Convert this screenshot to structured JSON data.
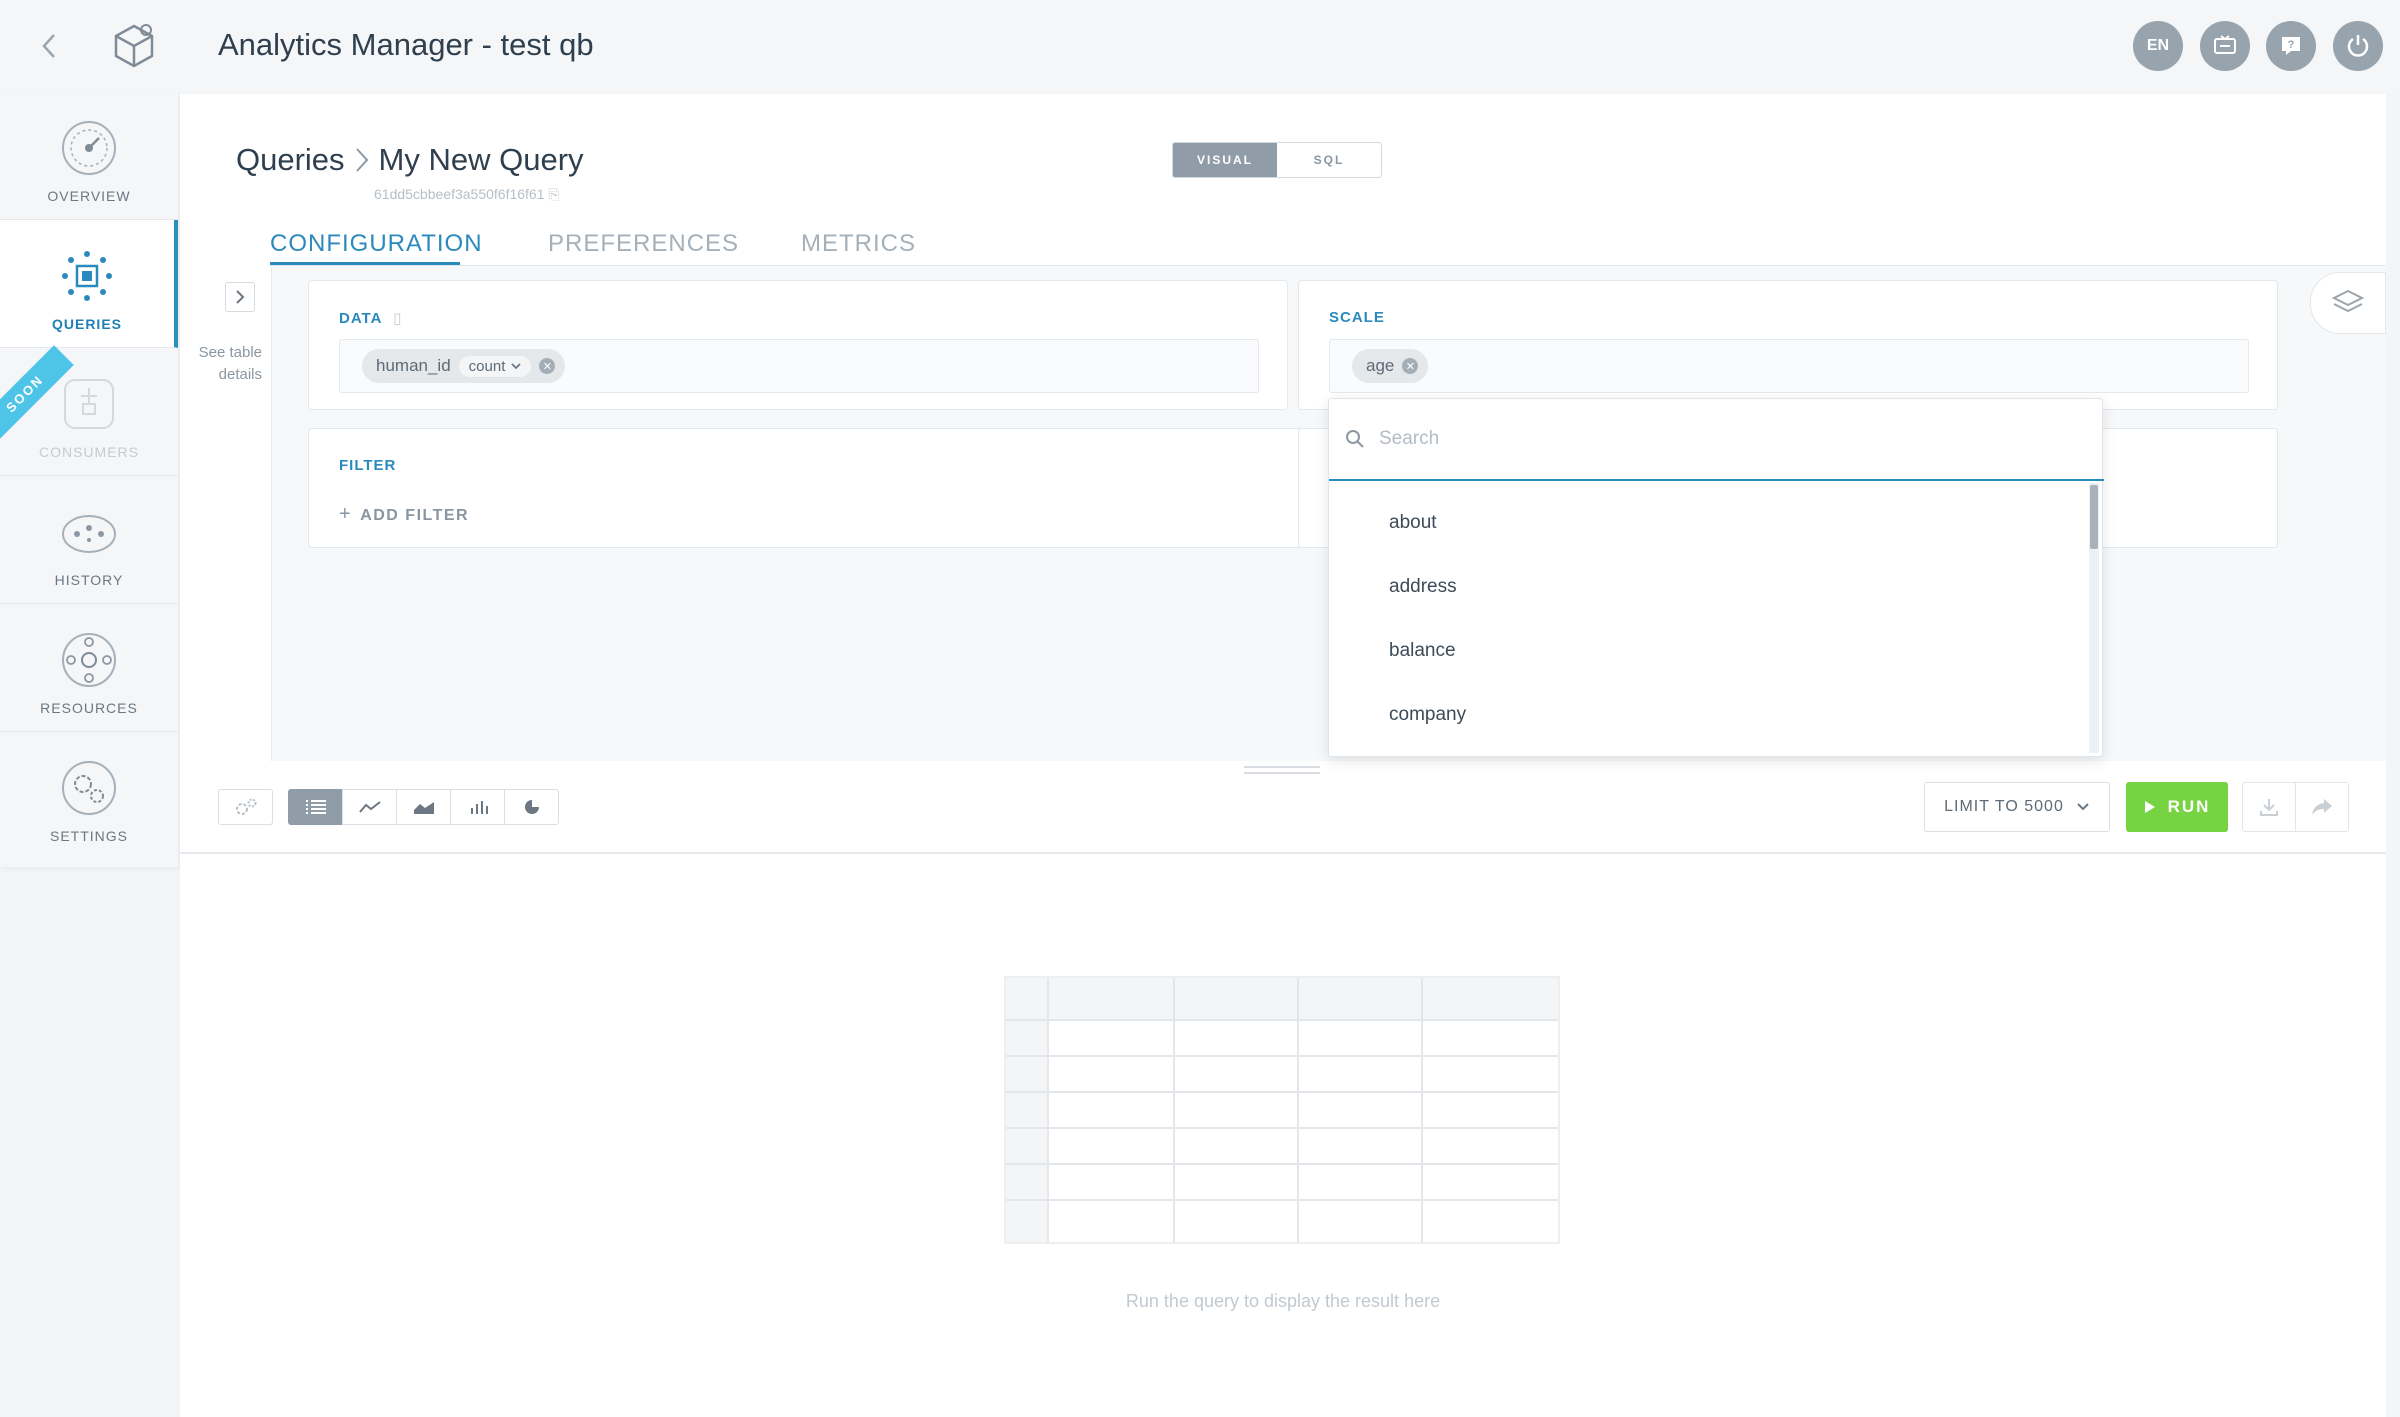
{
  "header": {
    "title": "Analytics Manager - test qb",
    "language": "EN",
    "icons": [
      "chevron-left-icon",
      "cube-logo-icon",
      "screen-icon",
      "help-icon",
      "power-icon"
    ]
  },
  "sidebar": {
    "items": [
      {
        "label": "OVERVIEW",
        "icon": "overview-icon",
        "active": false
      },
      {
        "label": "QUERIES",
        "icon": "queries-icon",
        "active": true
      },
      {
        "label": "CONSUMERS",
        "icon": "consumers-icon",
        "active": false,
        "disabled": true,
        "badge": "SOON"
      },
      {
        "label": "HISTORY",
        "icon": "history-icon",
        "active": false
      },
      {
        "label": "RESOURCES",
        "icon": "resources-icon",
        "active": false
      },
      {
        "label": "SETTINGS",
        "icon": "settings-icon",
        "active": false
      }
    ]
  },
  "breadcrumb": {
    "parent": "Queries",
    "current": "My New Query",
    "id": "61dd5cbbeef3a550f6f16f61"
  },
  "mode": {
    "visual": "VISUAL",
    "sql": "SQL",
    "selected": "VISUAL"
  },
  "tabs": [
    {
      "label": "CONFIGURATION",
      "active": true
    },
    {
      "label": "PREFERENCES",
      "active": false
    },
    {
      "label": "METRICS",
      "active": false
    }
  ],
  "details": {
    "label": "See table details"
  },
  "data_panel": {
    "label": "DATA",
    "chip": {
      "field": "human_id",
      "aggregation": "count"
    }
  },
  "scale_panel": {
    "label": "SCALE",
    "chip": {
      "field": "age"
    }
  },
  "filter_panel": {
    "label": "FILTER",
    "add_label": "ADD FILTER"
  },
  "dropdown": {
    "search_placeholder": "Search",
    "options": [
      "about",
      "address",
      "balance",
      "company"
    ]
  },
  "toolbar": {
    "viz_types": [
      "table-view-icon",
      "line-chart-icon",
      "area-chart-icon",
      "bar-chart-icon",
      "pie-chart-icon"
    ],
    "selected_viz": "table-view-icon",
    "limit_label": "LIMIT TO 5000",
    "run_label": "RUN"
  },
  "result": {
    "hint": "Run the query to display the result here"
  },
  "colors": {
    "accent": "#2a8abd",
    "run": "#76d342",
    "header_button": "#97a3ad"
  }
}
